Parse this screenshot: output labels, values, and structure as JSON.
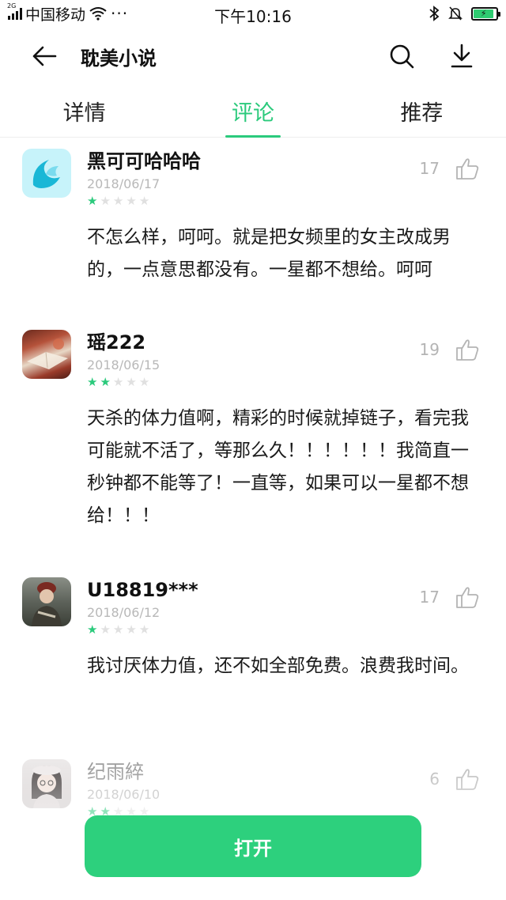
{
  "status_bar": {
    "network_tag": "2G",
    "carrier": "中国移动",
    "more": "···",
    "time": "下午10:16",
    "icons": [
      "signal-icon",
      "wifi-icon",
      "bluetooth-icon",
      "mute-bell-icon",
      "battery-icon"
    ],
    "battery_level": 0.9
  },
  "app_bar": {
    "title": "耽美小说",
    "icons": [
      "back-arrow-icon",
      "search-icon",
      "download-icon"
    ]
  },
  "tabs": [
    {
      "label": "详情",
      "active": false
    },
    {
      "label": "评论",
      "active": true
    },
    {
      "label": "推荐",
      "active": false
    }
  ],
  "colors": {
    "accent": "#2bca7c",
    "button": "#2dd07d",
    "star_off": "#e0e0e0",
    "muted": "#b8b8b8"
  },
  "reviews": [
    {
      "username": "黑可可哈哈哈",
      "date": "2018/06/17",
      "rating": 1,
      "likes": "17",
      "text": "不怎么样，呵呵。就是把女频里的女主改成男的，一点意思都没有。一星都不想给。呵呵"
    },
    {
      "username": "瑶222",
      "date": "2018/06/15",
      "rating": 2,
      "likes": "19",
      "text": "天杀的体力值啊，精彩的时候就掉链子，看完我可能就不活了，等那么久！！！！！！我简直一秒钟都不能等了！一直等，如果可以一星都不想给！！！"
    },
    {
      "username": "U18819***",
      "date": "2018/06/12",
      "rating": 1,
      "likes": "17",
      "text": "我讨厌体力值，还不如全部免费。浪费我时间。"
    },
    {
      "username": "纪雨綷",
      "date": "2018/06/10",
      "rating": 2,
      "likes": "6",
      "text": ""
    }
  ],
  "open_button": {
    "label": "打开"
  }
}
